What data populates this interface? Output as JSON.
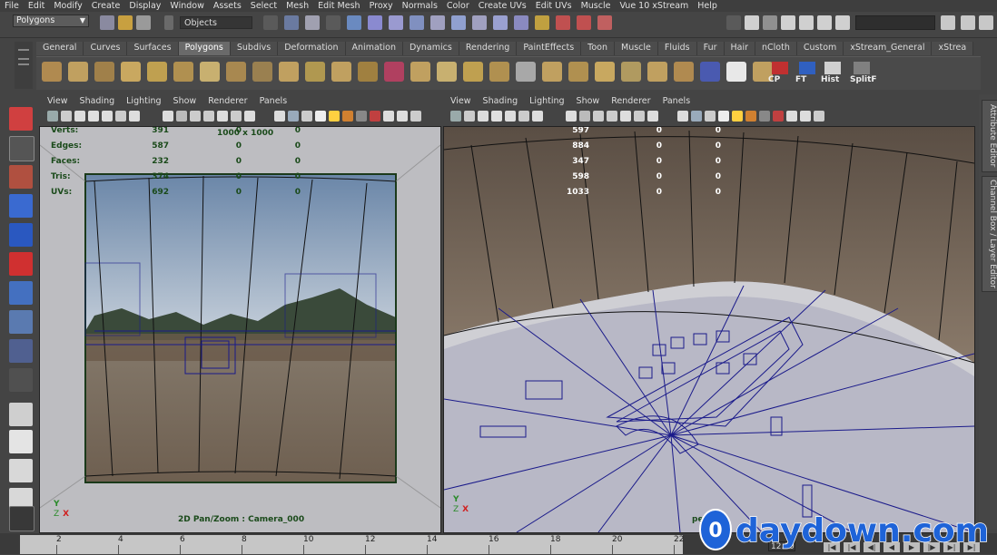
{
  "menubar": {
    "items": [
      "File",
      "Edit",
      "Modify",
      "Create",
      "Display",
      "Window",
      "Assets",
      "Select",
      "Mesh",
      "Edit Mesh",
      "Proxy",
      "Normals",
      "Color",
      "Create UVs",
      "Edit UVs",
      "Muscle",
      "Vue 10 xStream",
      "Help"
    ]
  },
  "statusline": {
    "mode": "Polygons",
    "object_field": "Objects"
  },
  "shelf": {
    "tabs": [
      "General",
      "Curves",
      "Surfaces",
      "Polygons",
      "Subdivs",
      "Deformation",
      "Animation",
      "Dynamics",
      "Rendering",
      "PaintEffects",
      "Toon",
      "Muscle",
      "Fluids",
      "Fur",
      "Hair",
      "nCloth",
      "Custom",
      "xStream_General",
      "xStrea"
    ],
    "active_tab": "Polygons",
    "labeled_buttons": [
      "CP",
      "FT",
      "Hist",
      "SplitF"
    ]
  },
  "left_viewport": {
    "menu": [
      "View",
      "Shading",
      "Lighting",
      "Show",
      "Renderer",
      "Panels"
    ],
    "hud": [
      {
        "label": "Verts:",
        "a": "391",
        "b": "0",
        "c": "0"
      },
      {
        "label": "Edges:",
        "a": "587",
        "b": "0",
        "c": "0"
      },
      {
        "label": "Faces:",
        "a": "232",
        "b": "0",
        "c": "0"
      },
      {
        "label": "Tris:",
        "a": "374",
        "b": "0",
        "c": "0"
      },
      {
        "label": "UVs:",
        "a": "692",
        "b": "0",
        "c": "0"
      }
    ],
    "resolution": "1000 x 1000",
    "camera_label": "2D Pan/Zoom : Camera_000"
  },
  "right_viewport": {
    "menu": [
      "View",
      "Shading",
      "Lighting",
      "Show",
      "Renderer",
      "Panels"
    ],
    "hud": [
      {
        "label": "",
        "a": "597",
        "b": "0",
        "c": "0"
      },
      {
        "label": "",
        "a": "884",
        "b": "0",
        "c": "0"
      },
      {
        "label": "",
        "a": "347",
        "b": "0",
        "c": "0"
      },
      {
        "label": "",
        "a": "598",
        "b": "0",
        "c": "0"
      },
      {
        "label": "",
        "a": "1033",
        "b": "0",
        "c": "0"
      }
    ],
    "camera_label": "pe"
  },
  "right_panel": {
    "tabs": [
      "Attribute Editor",
      "Channel Box / Layer Editor"
    ]
  },
  "timeline": {
    "ticks": [
      "2",
      "4",
      "6",
      "8",
      "10",
      "12",
      "14",
      "16",
      "18",
      "20",
      "22"
    ],
    "current_frame": "12.00"
  },
  "watermark": {
    "text": "daydown.com",
    "badge": "0"
  },
  "colors": {
    "accent": "#6a6a6a",
    "hud_green": "#1a4a1a",
    "hud_white": "#ffffff",
    "wire": "#1a1a8a",
    "watermark": "#1e63d8"
  }
}
